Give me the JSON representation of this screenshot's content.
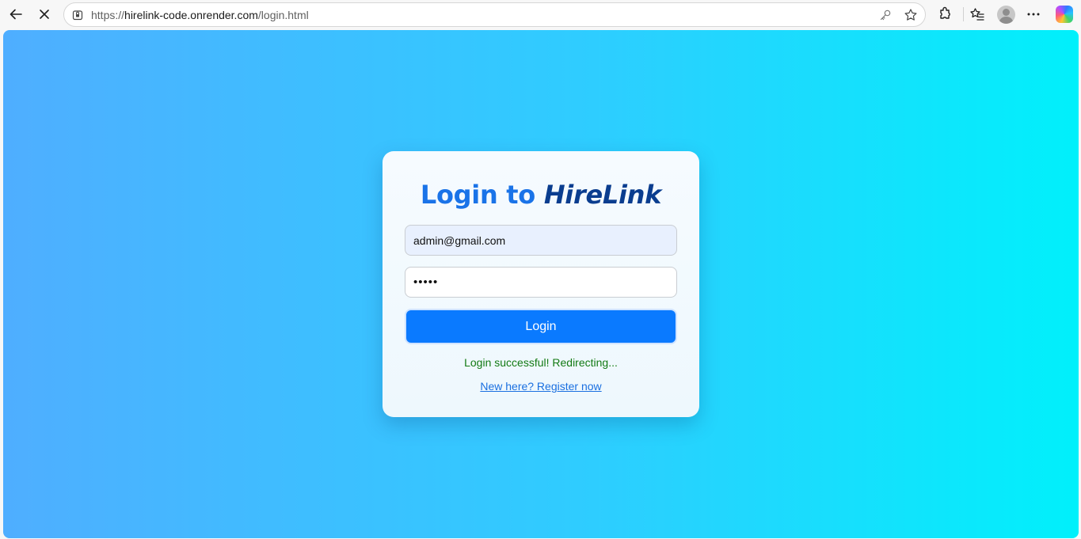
{
  "browser": {
    "url_protocol": "https://",
    "url_host": "hirelink-code.onrender.com",
    "url_path": "/login.html"
  },
  "login": {
    "title_prefix": "Login to ",
    "title_brand": "HireLink",
    "email_value": "admin@gmail.com",
    "password_mask": "•••••",
    "button_label": "Login",
    "status_message": "Login successful! Redirecting...",
    "register_link": "New here? Register now"
  },
  "colors": {
    "accent": "#0a7aff",
    "brand": "#0a3d8f",
    "title": "#1a73e8",
    "success": "#137a13",
    "link": "#1a6fe0"
  },
  "icons": [
    "back-arrow-icon",
    "stop-icon",
    "site-info-icon",
    "password-key-icon",
    "favorite-star-icon",
    "extensions-icon",
    "favorites-icon",
    "profile-avatar-icon",
    "more-options-icon",
    "copilot-icon"
  ]
}
